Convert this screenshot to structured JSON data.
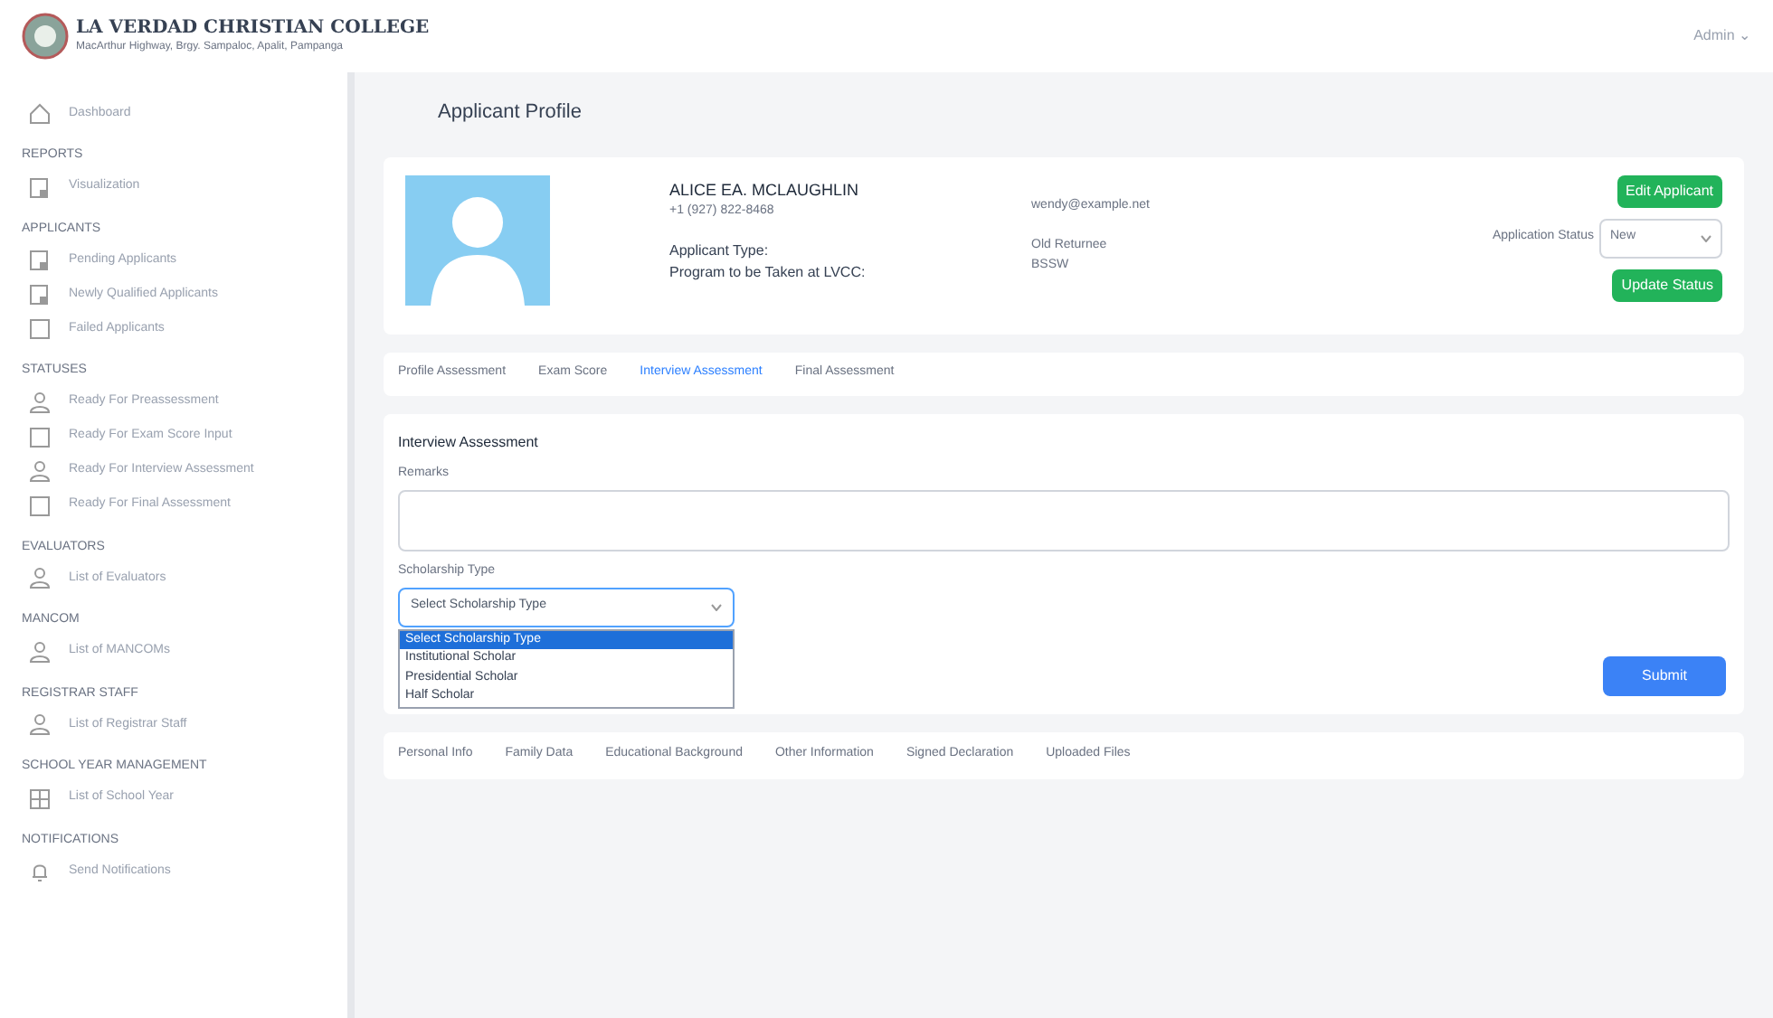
{
  "header": {
    "college_name": "LA VERDAD CHRISTIAN COLLEGE",
    "address": "MacArthur Highway, Brgy. Sampaloc, Apalit, Pampanga",
    "user_menu": "Admin ⌄"
  },
  "sidebar": {
    "items": [
      {
        "kind": "link",
        "label": "Dashboard"
      },
      {
        "kind": "section",
        "label": "REPORTS"
      },
      {
        "kind": "link",
        "label": "Visualization"
      },
      {
        "kind": "section",
        "label": "APPLICANTS"
      },
      {
        "kind": "link",
        "label": "Pending Applicants"
      },
      {
        "kind": "link",
        "label": "Newly Qualified Applicants"
      },
      {
        "kind": "link",
        "label": "Failed Applicants"
      },
      {
        "kind": "section",
        "label": "STATUSES"
      },
      {
        "kind": "link",
        "label": "Ready For Preassessment"
      },
      {
        "kind": "link",
        "label": "Ready For Exam Score Input"
      },
      {
        "kind": "link",
        "label": "Ready For Interview Assessment"
      },
      {
        "kind": "link",
        "label": "Ready For Final Assessment"
      },
      {
        "kind": "section",
        "label": "EVALUATORS"
      },
      {
        "kind": "link",
        "label": "List of Evaluators"
      },
      {
        "kind": "section",
        "label": "MANCOM"
      },
      {
        "kind": "link",
        "label": "List of MANCOMs"
      },
      {
        "kind": "section",
        "label": "REGISTRAR STAFF"
      },
      {
        "kind": "link",
        "label": "List of Registrar Staff"
      },
      {
        "kind": "section",
        "label": "SCHOOL YEAR MANAGEMENT"
      },
      {
        "kind": "link",
        "label": "List of School Year"
      },
      {
        "kind": "section",
        "label": "NOTIFICATIONS"
      },
      {
        "kind": "link",
        "label": "Send Notifications"
      }
    ]
  },
  "page_title": "Applicant Profile",
  "profile": {
    "name": "ALICE EA. MCLAUGHLIN",
    "phone": "+1 (927) 822-8468",
    "email": "wendy@example.net",
    "applicant_type_label": "Applicant Type:",
    "applicant_type": "Old Returnee",
    "program_label": "Program to be Taken at LVCC:",
    "program": "BSSW",
    "edit_button": "Edit Applicant",
    "status_label": "Application Status",
    "status_value": "New",
    "update_button": "Update Status"
  },
  "assessment_tabs": [
    {
      "label": "Profile Assessment",
      "selected": false
    },
    {
      "label": "Exam Score",
      "selected": false
    },
    {
      "label": "Interview Assessment",
      "selected": true
    },
    {
      "label": "Final Assessment",
      "selected": false
    }
  ],
  "interview": {
    "title": "Interview Assessment",
    "remarks_label": "Remarks",
    "scholarship_label": "Scholarship Type",
    "scholarship_value": "Select Scholarship Type",
    "options": [
      {
        "label": "Select Scholarship Type",
        "selected": true
      },
      {
        "label": "Institutional Scholar",
        "selected": false
      },
      {
        "label": "Presidential Scholar",
        "selected": false
      },
      {
        "label": "Half Scholar",
        "selected": false
      }
    ],
    "submit_button": "Submit"
  },
  "info_tabs": [
    {
      "label": "Personal Info"
    },
    {
      "label": "Family Data"
    },
    {
      "label": "Educational Background"
    },
    {
      "label": "Other Information"
    },
    {
      "label": "Signed Declaration"
    },
    {
      "label": "Uploaded Files"
    }
  ]
}
